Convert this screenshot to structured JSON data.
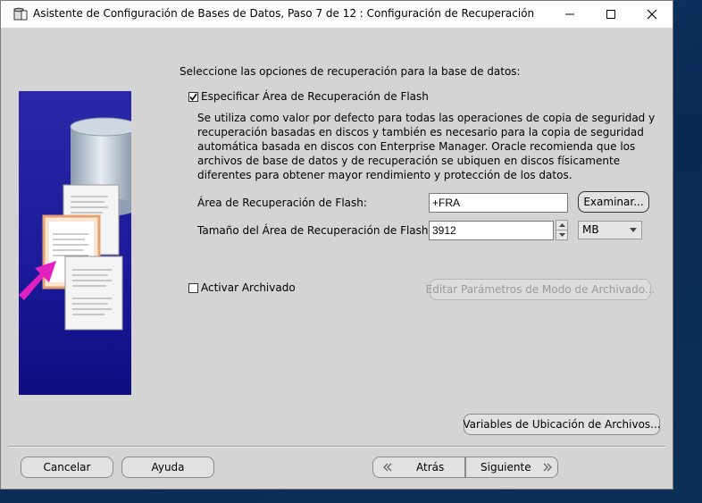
{
  "window": {
    "title": "Asistente de Configuración de Bases de Datos, Paso 7 de 12 : Configuración de Recuperación"
  },
  "intro": "Seleccione las opciones de recuperación para la base de datos:",
  "flash": {
    "checkbox_label": "Especificar Área de Recuperación de Flash",
    "checked": true,
    "description": "Se utiliza como valor por defecto para todas las operaciones de copia de seguridad y recuperación basadas en discos y también es necesario para la copia de seguridad automática basada en discos con Enterprise Manager. Oracle recomienda que los archivos de base de datos y de recuperación se ubiquen en discos físicamente diferentes para obtener mayor rendimiento y protección de los datos.",
    "area_label": "Área de Recuperación de Flash:",
    "area_value": "+FRA",
    "browse_label": "Examinar...",
    "size_label": "Tamaño del Área de Recuperación de Flash:",
    "size_value": "3912",
    "unit_value": "MB"
  },
  "archive": {
    "checkbox_label": "Activar Archivado",
    "checked": false,
    "edit_label": "Editar Parámetros de Modo de Archivado..."
  },
  "file_locations_label": "Variables de Ubicación de Archivos...",
  "footer": {
    "cancel_label": "Cancelar",
    "help_label": "Ayuda",
    "back_label": "Atrás",
    "next_label": "Siguiente"
  },
  "icons": {
    "app": "database-icon",
    "back": "chevron-left-icon",
    "next": "chevron-right-icon"
  }
}
